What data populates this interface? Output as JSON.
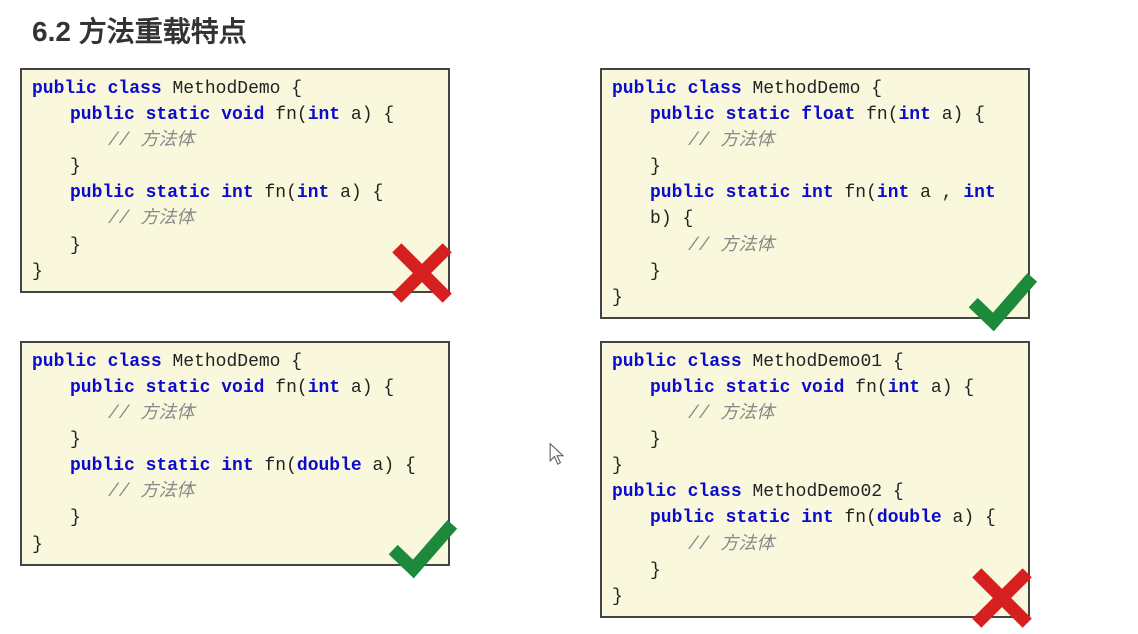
{
  "heading": "6.2 方法重载特点",
  "kw": {
    "public": "public",
    "class": "class",
    "static": "static",
    "void": "void",
    "int": "int",
    "float": "float",
    "double": "double"
  },
  "comment": "// 方法体",
  "box1": {
    "className": "MethodDemo",
    "m1_ret": "void",
    "m1_name": "fn",
    "m1_params": "int a",
    "m2_ret": "int",
    "m2_name": "fn",
    "m2_params": "int a",
    "status": "wrong"
  },
  "box2": {
    "className": "MethodDemo",
    "m1_ret": "float",
    "m1_name": "fn",
    "m1_params": "int a",
    "m2_ret": "int",
    "m2_name": "fn",
    "m2_params": "int a , int b",
    "status": "correct"
  },
  "box3": {
    "className": "MethodDemo",
    "m1_ret": "void",
    "m1_name": "fn",
    "m1_params": "int a",
    "m2_ret": "int",
    "m2_name": "fn",
    "m2_params": "double a",
    "status": "correct"
  },
  "box4": {
    "className1": "MethodDemo01",
    "m1_ret": "void",
    "m1_name": "fn",
    "m1_params": "int a",
    "className2": "MethodDemo02",
    "m2_ret": "int",
    "m2_name": "fn",
    "m2_params": "double a",
    "status": "wrong"
  },
  "glyphs": {
    "obrace": "{",
    "cbrace": "}",
    "lparen": "(",
    "rparen": ")"
  }
}
